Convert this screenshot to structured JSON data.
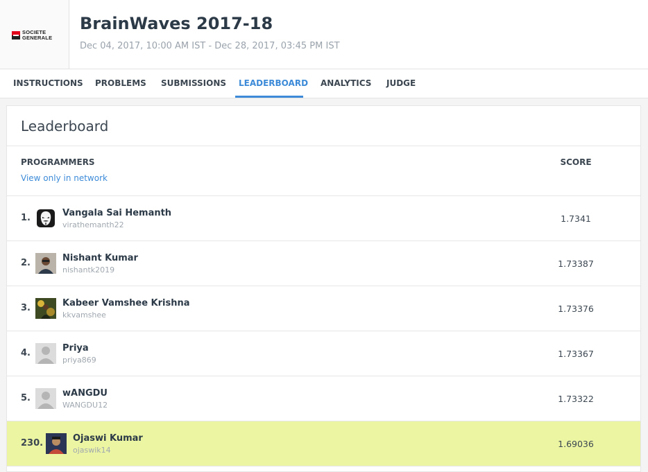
{
  "header": {
    "logo_text_line1": "SOCIETE",
    "logo_text_line2": "GENERALE",
    "title": "BrainWaves 2017-18",
    "dates": "Dec 04, 2017, 10:00 AM IST - Dec 28, 2017, 03:45 PM IST"
  },
  "tabs": [
    {
      "label": "INSTRUCTIONS"
    },
    {
      "label": "PROBLEMS"
    },
    {
      "label": "SUBMISSIONS"
    },
    {
      "label": "LEADERBOARD",
      "active": true
    },
    {
      "label": "ANALYTICS"
    },
    {
      "label": "JUDGE"
    }
  ],
  "leaderboard": {
    "title": "Leaderboard",
    "col_programmers": "PROGRAMMERS",
    "col_score": "SCORE",
    "network_link": "View only in network",
    "rows": [
      {
        "rank": "1.",
        "name": "Vangala Sai Hemanth",
        "handle": "virathemanth22",
        "score": "1.7341",
        "avatar": "mask-avatar"
      },
      {
        "rank": "2.",
        "name": "Nishant Kumar",
        "handle": "nishantk2019",
        "score": "1.73387",
        "avatar": "photo-avatar"
      },
      {
        "rank": "3.",
        "name": "Kabeer Vamshee Krishna",
        "handle": "kkvamshee",
        "score": "1.73376",
        "avatar": "photo-avatar"
      },
      {
        "rank": "4.",
        "name": "Priya",
        "handle": "priya869",
        "score": "1.73367",
        "avatar": "default-user-avatar"
      },
      {
        "rank": "5.",
        "name": "wANGDU",
        "handle": "WANGDU12",
        "score": "1.73322",
        "avatar": "default-user-avatar"
      },
      {
        "rank": "230.",
        "name": "Ojaswi Kumar",
        "handle": "ojaswik14",
        "score": "1.69036",
        "avatar": "photo-avatar",
        "current_user": true
      }
    ]
  },
  "colors": {
    "accent": "#3d8bd8",
    "highlight_row": "#ecf5a2",
    "brand_red": "#e2001a"
  }
}
